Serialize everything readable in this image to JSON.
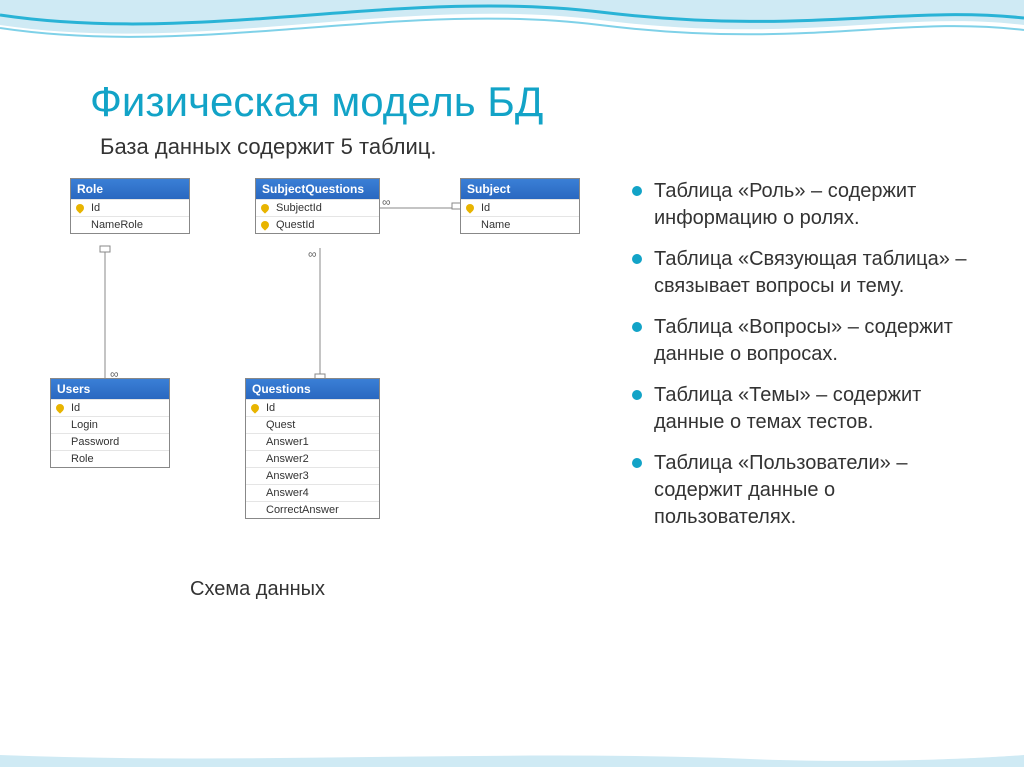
{
  "title": "Физическая модель БД",
  "subtitle": "База данных содержит 5 таблиц.",
  "caption": "Схема данных",
  "tables": {
    "role": {
      "name": "Role",
      "fields": [
        {
          "label": "Id",
          "pk": true
        },
        {
          "label": "NameRole",
          "pk": false
        }
      ]
    },
    "subjectQuestions": {
      "name": "SubjectQuestions",
      "fields": [
        {
          "label": "SubjectId",
          "pk": true
        },
        {
          "label": "QuestId",
          "pk": true
        }
      ]
    },
    "subject": {
      "name": "Subject",
      "fields": [
        {
          "label": "Id",
          "pk": true
        },
        {
          "label": "Name",
          "pk": false
        }
      ]
    },
    "users": {
      "name": "Users",
      "fields": [
        {
          "label": "Id",
          "pk": true
        },
        {
          "label": "Login",
          "pk": false
        },
        {
          "label": "Password",
          "pk": false
        },
        {
          "label": "Role",
          "pk": false
        }
      ]
    },
    "questions": {
      "name": "Questions",
      "fields": [
        {
          "label": "Id",
          "pk": true
        },
        {
          "label": "Quest",
          "pk": false
        },
        {
          "label": "Answer1",
          "pk": false
        },
        {
          "label": "Answer2",
          "pk": false
        },
        {
          "label": "Answer3",
          "pk": false
        },
        {
          "label": "Answer4",
          "pk": false
        },
        {
          "label": "CorrectAnswer",
          "pk": false
        }
      ]
    }
  },
  "bullets": [
    "Таблица «Роль» – содержит информацию о ролях.",
    "Таблица «Связующая таблица» – связывает вопросы и тему.",
    "Таблица «Вопросы» – содержит данные о вопросах.",
    "Таблица «Темы» – содержит данные о темах тестов.",
    "Таблица «Пользователи» – содержит данные о пользователях."
  ]
}
